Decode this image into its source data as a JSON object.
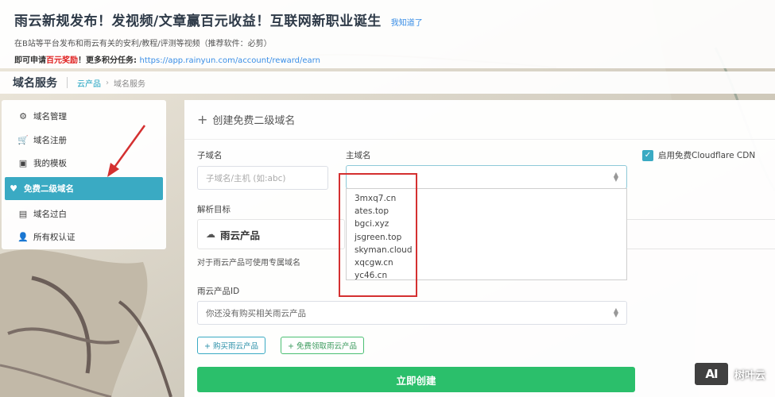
{
  "notice": {
    "title": "雨云新规发布！发视频/文章赢百元收益！互联网新职业诞生",
    "dismiss": "我知道了",
    "line1": "在B站等平台发布和雨云有关的安利/教程/评测等视频（推荐软件：必剪）",
    "line2_prefix": "即可申请",
    "line2_red": "百元奖励",
    "line2_mid": "！更多积分任务: ",
    "line2_link": "https://app.rainyun.com/account/reward/earn"
  },
  "header": {
    "title": "域名服务",
    "breadcrumb": [
      "云产品",
      "域名服务"
    ],
    "breadcrumb_sep": "›"
  },
  "sidebar": {
    "items": [
      {
        "label": "域名管理",
        "icon": "gears-icon",
        "glyph": "⚙"
      },
      {
        "label": "域名注册",
        "icon": "cart-icon",
        "glyph": "🛒"
      },
      {
        "label": "我的模板",
        "icon": "id-card-icon",
        "glyph": "▣"
      },
      {
        "label": "免费二级域名",
        "icon": "heart-icon",
        "glyph": "♥",
        "active": true
      },
      {
        "label": "域名过白",
        "icon": "inbox-icon",
        "glyph": "▤"
      },
      {
        "label": "所有权认证",
        "icon": "user-check-icon",
        "glyph": "👤"
      }
    ]
  },
  "form": {
    "card_title": "创建免费二级域名",
    "card_title_icon": "+",
    "subdomain_label": "子域名",
    "subdomain_placeholder": "子域名/主机 (如:abc)",
    "main_domain_label": "主域名",
    "main_domain_value": "",
    "main_domain_options": [
      "3mxq7.cn",
      "ates.top",
      "bgci.xyz",
      "jsgreen.top",
      "skyman.cloud",
      "xqcgw.cn",
      "yc46.cn"
    ],
    "cloudflare_label": "启用免费Cloudflare CDN",
    "cloudflare_checked": true,
    "resolve_target_label": "解析目标",
    "product_option": "雨云产品",
    "product_hint": "对于雨云产品可使用专属域名",
    "product_id_label": "雨云产品ID",
    "product_id_placeholder": "你还没有购买相关雨云产品",
    "buy_button": "+ 购买雨云产品",
    "free_button": "+ 免费领取雨云产品",
    "create_button": "立即创建"
  },
  "watermark": {
    "logo": "AI",
    "text": "树叶云"
  },
  "colors": {
    "accent": "#3aaac3",
    "primary_green": "#2bbf6b",
    "annotation_red": "#d43030"
  }
}
